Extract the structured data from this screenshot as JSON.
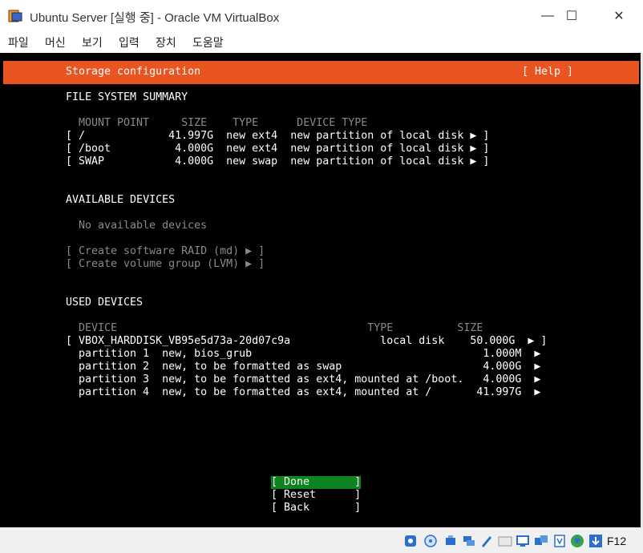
{
  "window": {
    "title": "Ubuntu Server [실행 중] - Oracle VM VirtualBox",
    "minimize_glyph": "—",
    "maximize_glyph": "☐",
    "close_glyph": "✕"
  },
  "menu": [
    "파일",
    "머신",
    "보기",
    "입력",
    "장치",
    "도움말"
  ],
  "screen": {
    "header_title": "Storage configuration",
    "header_help": "[ Help ]",
    "fs_summary": {
      "heading": "FILE SYSTEM SUMMARY",
      "columns": "MOUNT POINT     SIZE    TYPE      DEVICE TYPE",
      "rows": [
        "[ /             41.997G  new ext4  new partition of local disk ▶ ]",
        "[ /boot          4.000G  new ext4  new partition of local disk ▶ ]",
        "[ SWAP           4.000G  new swap  new partition of local disk ▶ ]"
      ]
    },
    "available": {
      "heading": "AVAILABLE DEVICES",
      "empty": "No available devices",
      "raid": "[ Create software RAID (md) ▶ ]",
      "lvm": "[ Create volume group (LVM) ▶ ]"
    },
    "used": {
      "heading": "USED DEVICES",
      "columns": "DEVICE                                       TYPE          SIZE",
      "disk": "[ VBOX_HARDDISK_VB95e5d73a-20d07c9a              local disk    50.000G  ▶ ]",
      "partitions": [
        "partition 1  new, bios_grub                                    1.000M  ▶",
        "partition 2  new, to be formatted as swap                      4.000G  ▶",
        "partition 3  new, to be formatted as ext4, mounted at /boot.   4.000G  ▶",
        "partition 4  new, to be formatted as ext4, mounted at /       41.997G  ▶"
      ]
    },
    "buttons": {
      "done": "[ Done       ]",
      "reset": "[ Reset      ]",
      "back": "[ Back       ]"
    }
  },
  "statusbar": {
    "icons": [
      "hdd-icon",
      "optical-disk-icon",
      "audio-icon",
      "network-icon",
      "usb-icon",
      "shared-folder-icon",
      "display-icon",
      "recording-icon",
      "cpu-icon",
      "mouse-integration-icon",
      "keyboard-capture-icon"
    ],
    "hostkey": "F12"
  }
}
